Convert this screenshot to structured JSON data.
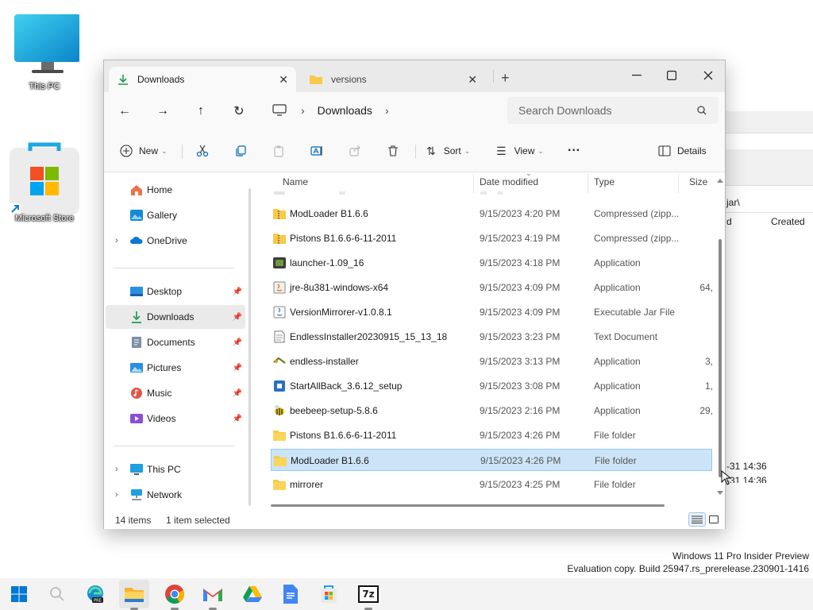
{
  "desktop": {
    "icons": [
      {
        "label": "This PC",
        "icon": "monitor-icon"
      },
      {
        "label": "Microsoft Store",
        "icon": "store-icon"
      }
    ]
  },
  "background_window": {
    "path_fragment": "jar\\",
    "col_fragment": "d",
    "col_created": "Created",
    "date1": "-31 14:36",
    "date2": "-31 14:36"
  },
  "explorer": {
    "tabs": [
      {
        "label": "Downloads",
        "icon": "download-icon",
        "active": true
      },
      {
        "label": "versions",
        "icon": "folder-icon",
        "active": false
      }
    ],
    "new_tab": "+",
    "address": {
      "location": "Downloads"
    },
    "search": {
      "placeholder": "Search Downloads"
    },
    "commands": {
      "new": "New",
      "sort": "Sort",
      "view": "View",
      "more": "···",
      "details": "Details"
    },
    "sidebar": {
      "items": [
        {
          "label": "Home",
          "icon": "home-icon"
        },
        {
          "label": "Gallery",
          "icon": "gallery-icon"
        },
        {
          "label": "OneDrive",
          "icon": "cloud-icon"
        },
        {
          "label": "Desktop",
          "icon": "desktop-icon"
        },
        {
          "label": "Downloads",
          "icon": "download-icon"
        },
        {
          "label": "Documents",
          "icon": "documents-icon"
        },
        {
          "label": "Pictures",
          "icon": "pictures-icon"
        },
        {
          "label": "Music",
          "icon": "music-icon"
        },
        {
          "label": "Videos",
          "icon": "videos-icon"
        },
        {
          "label": "This PC",
          "icon": "pc-icon"
        },
        {
          "label": "Network",
          "icon": "network-icon"
        }
      ]
    },
    "columns": {
      "name": "Name",
      "date": "Date modified",
      "type": "Type",
      "size": "Size"
    },
    "files": [
      {
        "name": "ModLoader B1.6.6",
        "date": "9/15/2023 4:20 PM",
        "type": "Compressed (zipp...",
        "size": "",
        "icon": "zip-folder-icon"
      },
      {
        "name": "Pistons B1.6.6-6-11-2011",
        "date": "9/15/2023 4:19 PM",
        "type": "Compressed (zipp...",
        "size": "",
        "icon": "zip-folder-icon"
      },
      {
        "name": "launcher-1.09_16",
        "date": "9/15/2023 4:18 PM",
        "type": "Application",
        "size": "",
        "icon": "launcher-app-icon"
      },
      {
        "name": "jre-8u381-windows-x64",
        "date": "9/15/2023 4:09 PM",
        "type": "Application",
        "size": "64,",
        "icon": "java-installer-icon"
      },
      {
        "name": "VersionMirrorer-v1.0.8.1",
        "date": "9/15/2023 4:09 PM",
        "type": "Executable Jar File",
        "size": "",
        "icon": "jar-file-icon"
      },
      {
        "name": "EndlessInstaller20230915_15_13_18",
        "date": "9/15/2023 3:23 PM",
        "type": "Text Document",
        "size": "",
        "icon": "text-file-icon"
      },
      {
        "name": "endless-installer",
        "date": "9/15/2023 3:13 PM",
        "type": "Application",
        "size": "3,",
        "icon": "installer-app-icon"
      },
      {
        "name": "StartAllBack_3.6.12_setup",
        "date": "9/15/2023 3:08 PM",
        "type": "Application",
        "size": "1,",
        "icon": "setup-app-icon"
      },
      {
        "name": "beebeep-setup-5.8.6",
        "date": "9/15/2023 2:16 PM",
        "type": "Application",
        "size": "29,",
        "icon": "bee-app-icon"
      },
      {
        "name": "Pistons B1.6.6-6-11-2011",
        "date": "9/15/2023 4:26 PM",
        "type": "File folder",
        "size": "",
        "icon": "folder-icon"
      },
      {
        "name": "ModLoader B1.6.6",
        "date": "9/15/2023 4:26 PM",
        "type": "File folder",
        "size": "",
        "icon": "folder-icon",
        "selected": true
      },
      {
        "name": "mirrorer",
        "date": "9/15/2023 4:25 PM",
        "type": "File folder",
        "size": "",
        "icon": "folder-icon"
      }
    ],
    "status": {
      "count": "14 items",
      "selection": "1 item selected"
    }
  },
  "watermark": {
    "line1": "Windows 11 Pro Insider Preview",
    "line2": "Evaluation copy. Build 25947.rs_prerelease.230901-1416"
  },
  "taskbar": {
    "apps": [
      "start-icon",
      "search-icon",
      "edge-pre-icon",
      "file-explorer-icon",
      "chrome-icon",
      "gmail-icon",
      "drive-icon",
      "docs-icon",
      "store-icon",
      "7zip-icon"
    ],
    "sevenzip_label": "7z"
  },
  "colors": {
    "selection": "#cce4f7",
    "selection_border": "#99c9ef",
    "folder": "#f8c94a",
    "accent": "#0067c0"
  }
}
